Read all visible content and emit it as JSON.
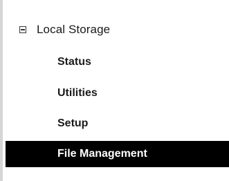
{
  "sidebar": {
    "section": {
      "label": "Local Storage",
      "toggle": "collapse-minus-icon",
      "expanded": true
    },
    "items": [
      {
        "label": "Status",
        "active": false
      },
      {
        "label": "Utilities",
        "active": false
      },
      {
        "label": "Setup",
        "active": false
      },
      {
        "label": "File Management",
        "active": true
      }
    ],
    "colors": {
      "active_background": "#000000",
      "active_text": "#ffffff",
      "text": "#1a1a1a",
      "panel_border": "#d6d6d6"
    }
  }
}
